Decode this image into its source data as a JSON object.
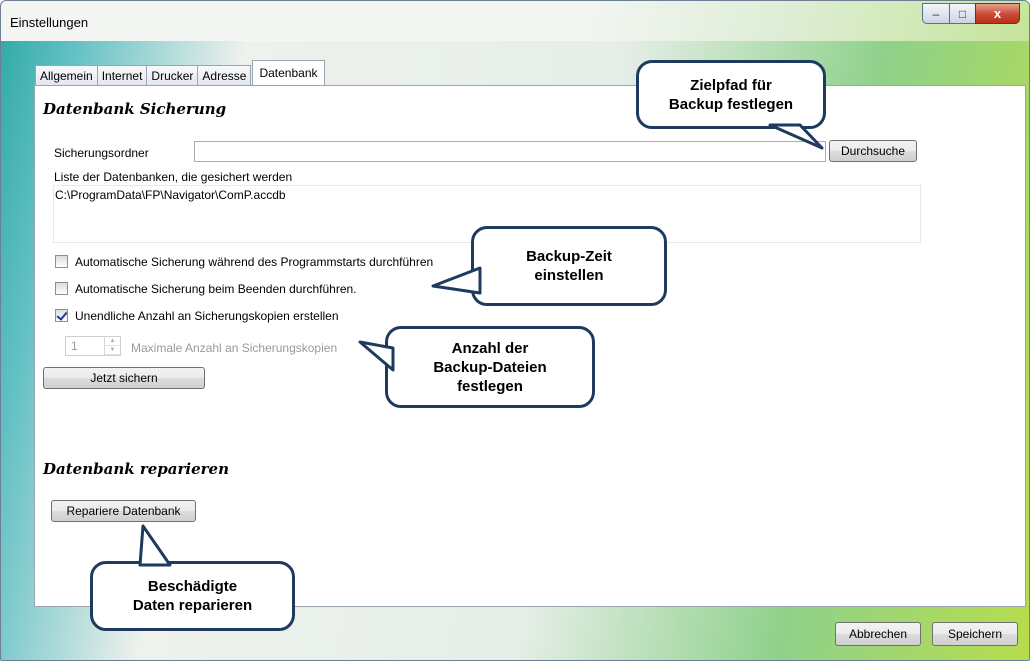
{
  "window": {
    "title": "Einstellungen",
    "minimize_glyph": "–",
    "maximize_glyph": "□",
    "close_glyph": "x"
  },
  "tabs": [
    {
      "label": "Allgemein"
    },
    {
      "label": "Internet"
    },
    {
      "label": "Drucker"
    },
    {
      "label": "Adresse"
    },
    {
      "label": "Datenbank",
      "active": true
    }
  ],
  "backup": {
    "heading": "Datenbank Sicherung",
    "folder_label": "Sicherungsordner",
    "folder_value": "",
    "browse_button": "Durchsuche",
    "list_label": "Liste der Datenbanken, die gesichert werden",
    "databases": [
      "C:\\ProgramData\\FP\\Navigator\\ComP.accdb"
    ],
    "options": [
      {
        "label": "Automatische Sicherung während des Programmstarts durchführen",
        "checked": false
      },
      {
        "label": "Automatische Sicherung beim Beenden durchführen.",
        "checked": false
      },
      {
        "label": "Unendliche Anzahl an Sicherungskopien erstellen",
        "checked": true
      }
    ],
    "max_copies_value": "1",
    "max_copies_label": "Maximale Anzahl an Sicherungskopien",
    "backup_now_button": "Jetzt sichern"
  },
  "repair": {
    "heading": "Datenbank reparieren",
    "repair_button": "Repariere Datenbank"
  },
  "footer": {
    "cancel_button": "Abbrechen",
    "save_button": "Speichern"
  },
  "callouts": {
    "target_path": [
      "Zielpfad für",
      "Backup festlegen"
    ],
    "backup_time": [
      "Backup-Zeit",
      "einstellen"
    ],
    "backup_count": [
      "Anzahl der",
      "Backup-Dateien",
      "festlegen"
    ],
    "repair_data": [
      "Beschädigte",
      "Daten reparieren"
    ]
  },
  "colors": {
    "callout_border": "#1e3a5f",
    "close_button": "#c94a32"
  }
}
